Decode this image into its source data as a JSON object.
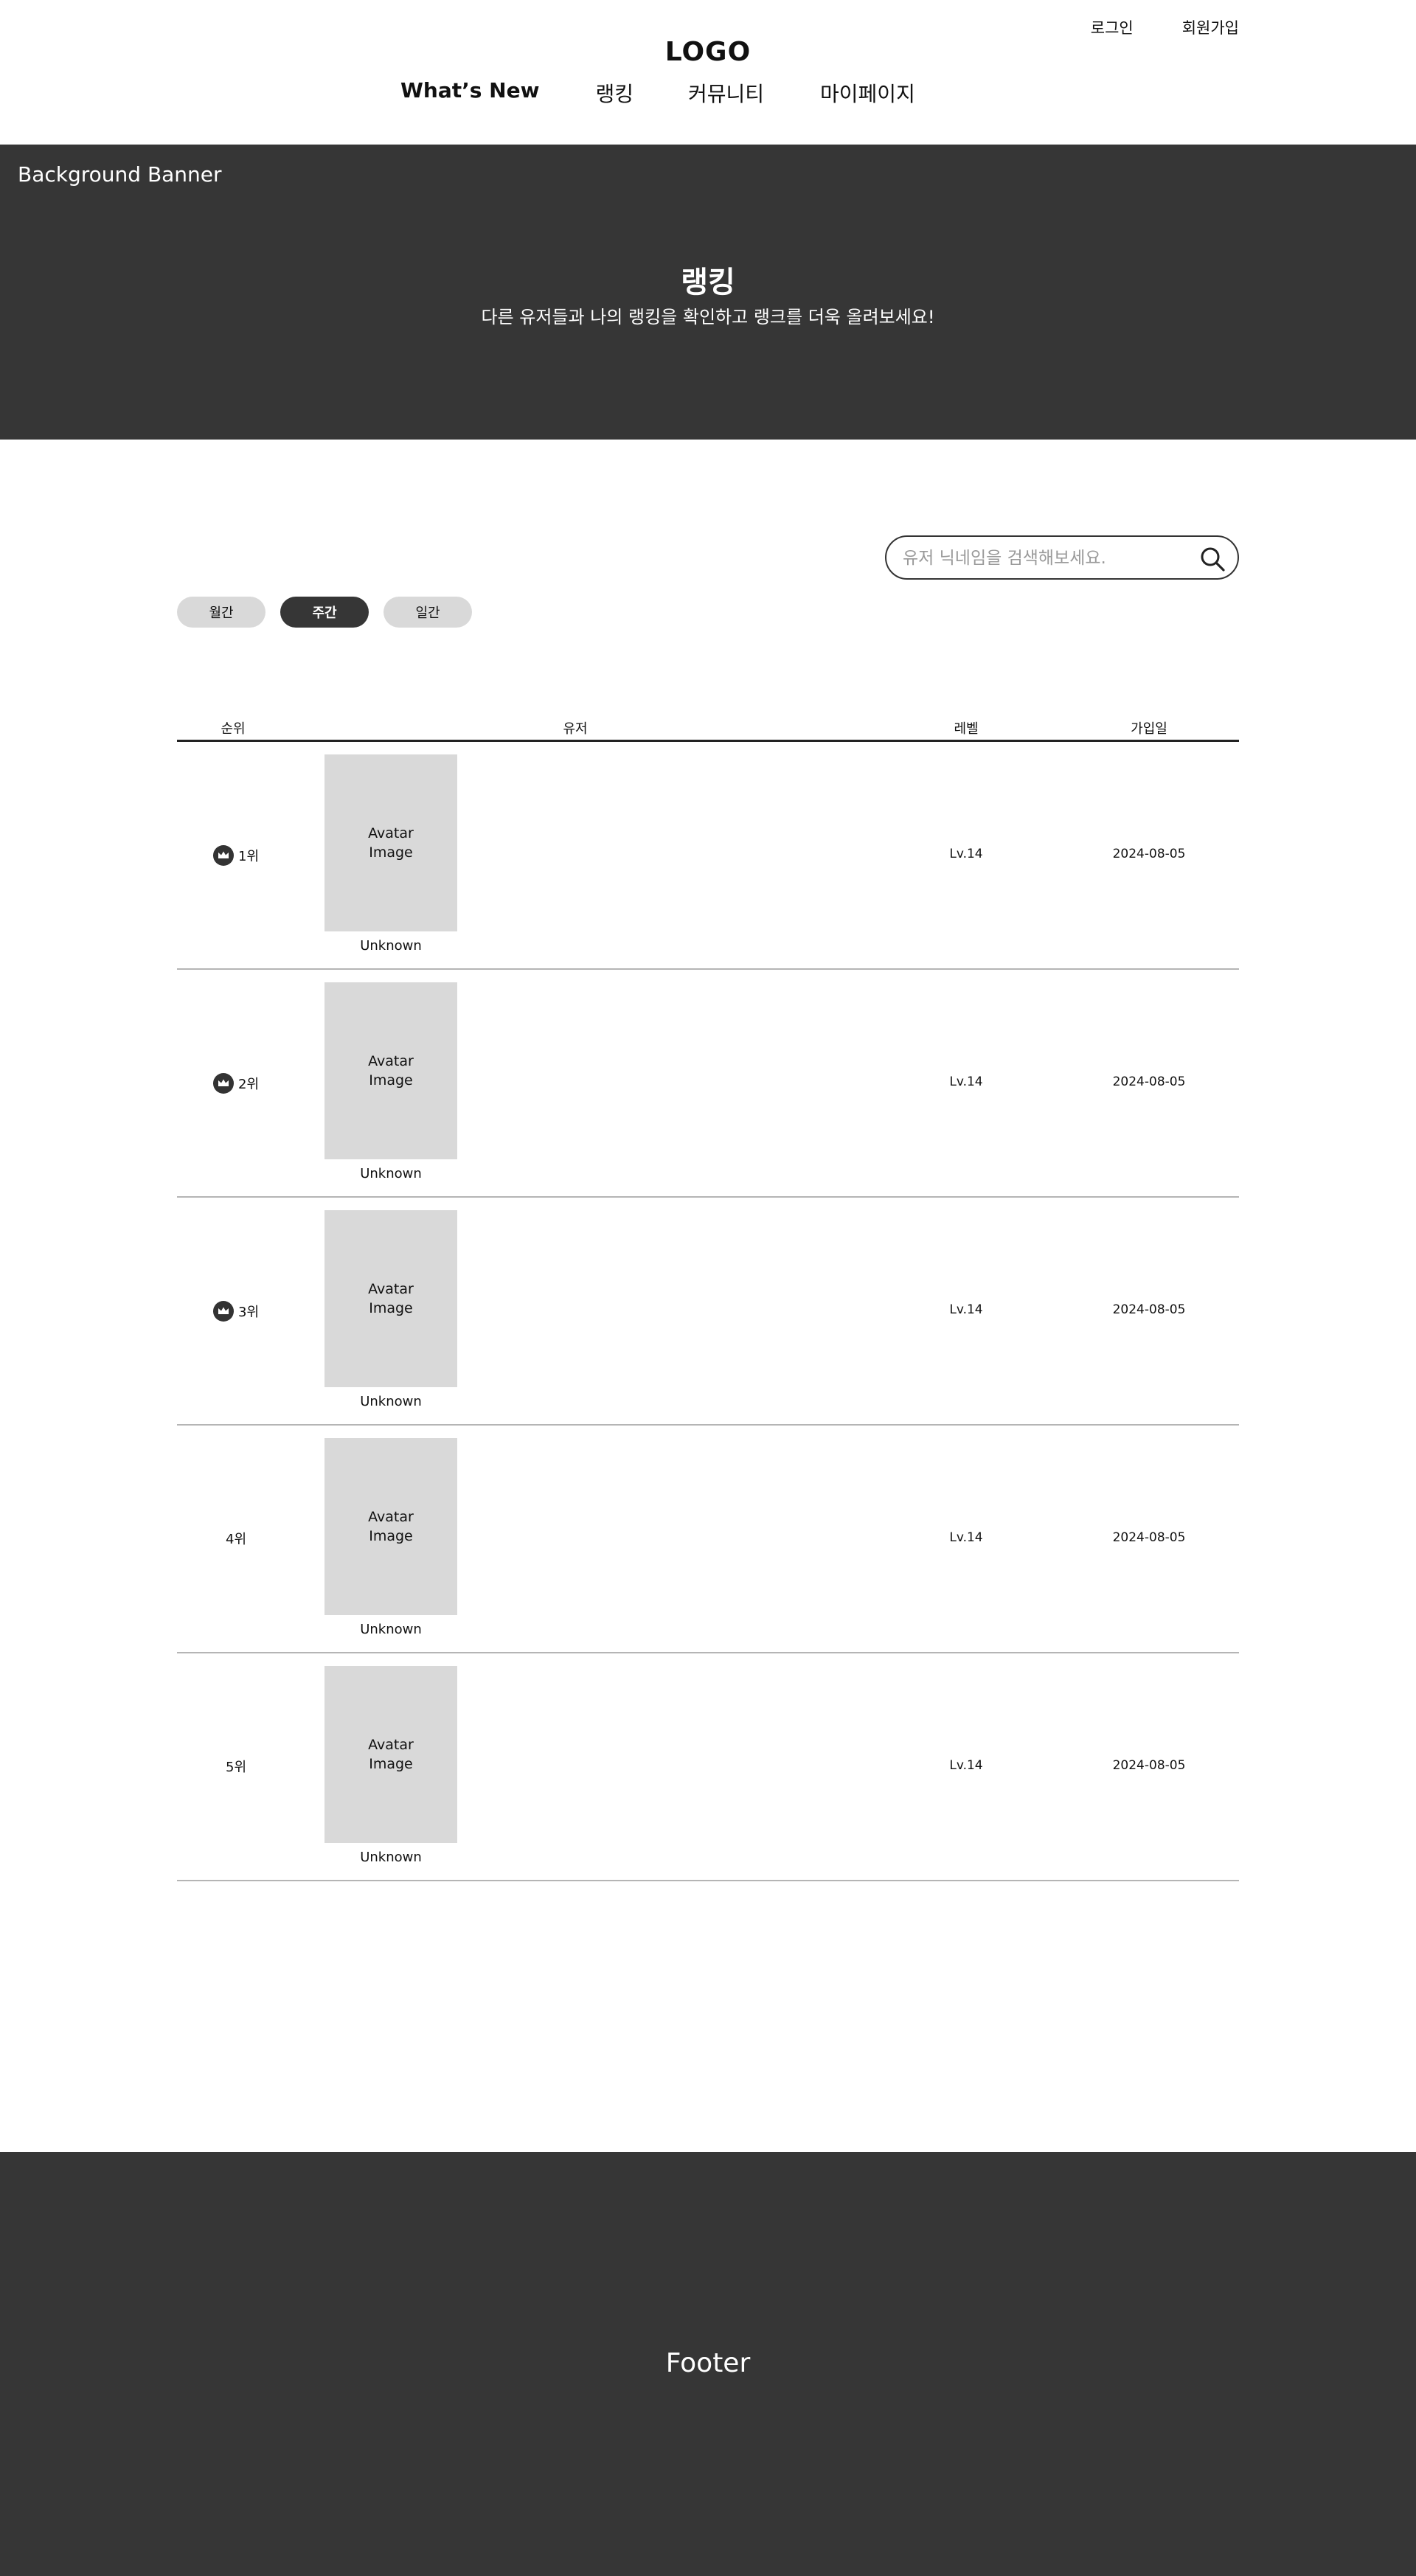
{
  "header": {
    "auth": {
      "login": "로그인",
      "signup": "회원가입"
    },
    "logo": "LOGO",
    "nav": [
      {
        "label": "What’s New"
      },
      {
        "label": "랭킹"
      },
      {
        "label": "커뮤니티"
      },
      {
        "label": "마이페이지"
      }
    ]
  },
  "banner": {
    "label": "Background Banner",
    "title": "랭킹",
    "subtitle": "다른 유저들과 나의 랭킹을 확인하고 랭크를 더욱 올려보세요!"
  },
  "search": {
    "placeholder": "유저 닉네임을 검색해보세요.",
    "icon": "search-icon"
  },
  "tabs": [
    {
      "label": "월간",
      "active": false
    },
    {
      "label": "주간",
      "active": true
    },
    {
      "label": "일간",
      "active": false
    }
  ],
  "table": {
    "headers": {
      "rank": "순위",
      "user": "유저",
      "level": "레벨",
      "joined": "가입일"
    },
    "rows": [
      {
        "rank": "1위",
        "crown": true,
        "avatar": "Avatar Image",
        "nickname": "Unknown",
        "level": "Lv.14",
        "joined": "2024-08-05"
      },
      {
        "rank": "2위",
        "crown": true,
        "avatar": "Avatar Image",
        "nickname": "Unknown",
        "level": "Lv.14",
        "joined": "2024-08-05"
      },
      {
        "rank": "3위",
        "crown": true,
        "avatar": "Avatar Image",
        "nickname": "Unknown",
        "level": "Lv.14",
        "joined": "2024-08-05"
      },
      {
        "rank": "4위",
        "crown": false,
        "avatar": "Avatar Image",
        "nickname": "Unknown",
        "level": "Lv.14",
        "joined": "2024-08-05"
      },
      {
        "rank": "5위",
        "crown": false,
        "avatar": "Avatar Image",
        "nickname": "Unknown",
        "level": "Lv.14",
        "joined": "2024-08-05"
      }
    ]
  },
  "footer": {
    "label": "Footer"
  },
  "colors": {
    "dark": "#363636",
    "placeholder_gray": "#d9d9d9",
    "divider": "#b5b5b5"
  }
}
